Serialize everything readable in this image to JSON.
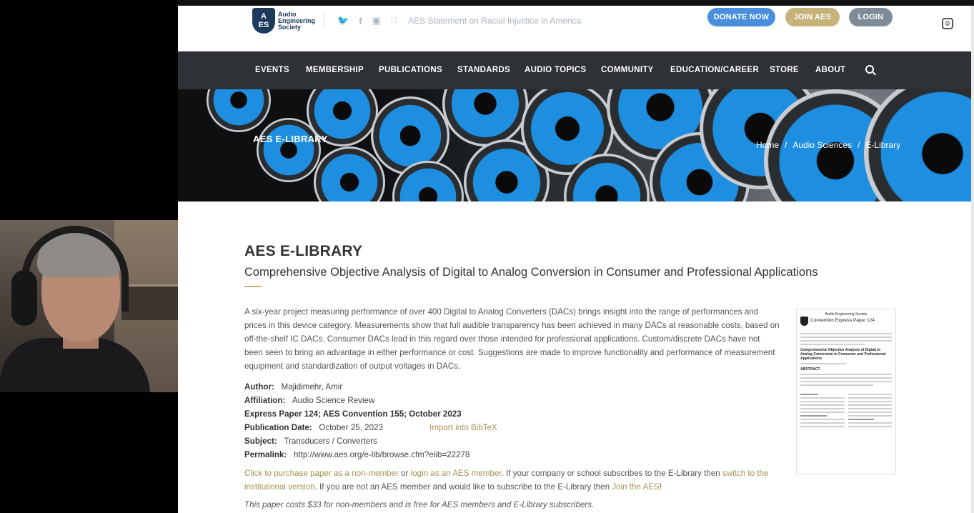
{
  "header": {
    "logo_line1": "A",
    "logo_line2": "ES",
    "logo_text": "Audio Engineering Society",
    "statement": "AES Statement on Racial Injustice in America",
    "donate": "DONATE NOW",
    "join": "JOIN AES",
    "login": "LOGIN"
  },
  "nav": {
    "items": [
      "EVENTS",
      "MEMBERSHIP",
      "PUBLICATIONS",
      "STANDARDS",
      "AUDIO TOPICS",
      "COMMUNITY",
      "EDUCATION/CAREER",
      "STORE",
      "ABOUT"
    ]
  },
  "hero": {
    "title": "AES E-LIBRARY",
    "breadcrumb": [
      "Home",
      "/",
      "Audio Sciences",
      "/",
      "E-Library"
    ]
  },
  "article": {
    "heading": "AES E-LIBRARY",
    "title": "Comprehensive Objective Analysis of Digital to Analog Conversion in Consumer and Professional Applications",
    "abstract": "A six-year project measuring performance of over 400 Digital to Analog Converters (DACs) brings insight into the range of performances and prices in this device category. Measurements show that full audible transparency has been achieved in many DACs at reasonable costs, based on off-the-shelf IC DACs. Consumer DACs lead in this regard over those intended for professional applications. Custom/discrete DACs have not been seen to bring an advantage in either performance or cost. Suggestions are made to improve functionality and performance of measurement equipment and standardization of output voltages in DACs.",
    "author_label": "Author:",
    "author": "Majidimehr, Amir",
    "affiliation_label": "Affiliation:",
    "affiliation": "Audio Science Review",
    "express": "Express Paper 124; AES Convention 155; October 2023",
    "pubdate_label": "Publication Date:",
    "pubdate": "October 25, 2023",
    "bibtex": "Import into BibTeX",
    "subject_label": "Subject:",
    "subject": "Transducers / Converters",
    "permalink_label": "Permalink:",
    "permalink": "http://www.aes.org/e-lib/browse.cfm?elib=22278",
    "purchase_link1": "Click to purchase paper as a non-member",
    "purchase_or": " or ",
    "purchase_link2": "login as an AES member",
    "purchase_mid": ". If your company or school subscribes to the E-Library then ",
    "purchase_link3": "switch to the institutional version",
    "purchase_mid2": ". If you are not an AES member and would like to subscribe to the E-Library then ",
    "purchase_link4": "Join the AES",
    "purchase_end": "!",
    "cost": "This paper costs $33 for non-members and is free for AES members and E-Library subscribers."
  },
  "thumbnail": {
    "org": "Audio Engineering Society",
    "paper": "Convention Express Paper 124",
    "heading": "Comprehensive Objective Analysis of Digital to Analog Conversion in Consumer and Professional Applications",
    "abstract_label": "ABSTRACT"
  },
  "colors": {
    "nav_bg": "#2e3237",
    "accent_gold": "#c7b27a",
    "donate_blue": "#4a8fde",
    "login_gray": "#7d8c98",
    "speaker_blue": "#1e8fe0"
  }
}
